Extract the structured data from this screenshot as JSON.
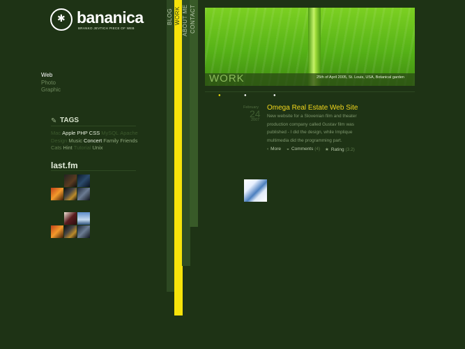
{
  "brand": {
    "name": "bananica",
    "tagline": "BRANKO JEVTICH PIECE OF WEB"
  },
  "left_nav": [
    "Web",
    "Photo",
    "Graphic"
  ],
  "tags": {
    "title": "TAGS",
    "lines": [
      [
        {
          "t": "Mac",
          "w": "dim"
        },
        {
          "t": "Apple",
          "w": "bright"
        },
        {
          "t": "PHP",
          "w": "bright"
        },
        {
          "t": "CSS",
          "w": "bright"
        },
        {
          "t": "MySQL",
          "w": "dim"
        },
        {
          "t": "Apache",
          "w": "dim"
        }
      ],
      [
        {
          "t": "Design",
          "w": "dim"
        },
        {
          "t": "Music",
          "w": "mid"
        },
        {
          "t": "Concert",
          "w": "bright"
        },
        {
          "t": "Family",
          "w": "mid"
        },
        {
          "t": "Friends",
          "w": "mid"
        }
      ],
      [
        {
          "t": "Cats",
          "w": "low"
        },
        {
          "t": "Hint",
          "w": "mid"
        },
        {
          "t": "Tutorial",
          "w": "dim"
        },
        {
          "t": "Unix",
          "w": "mid"
        }
      ]
    ]
  },
  "lastfm": {
    "title": "last.fm"
  },
  "vertical_nav": [
    "BLOG",
    "WORK",
    "ABOUT ME",
    "CONTACT"
  ],
  "hero": {
    "word": "WORK",
    "caption": "25th of April 2005, St. Louis, USA, Botanical garden"
  },
  "dots_colors": [
    "#f7e30a",
    "#ffffff",
    "#ffffff"
  ],
  "post": {
    "month": "February",
    "day": "24",
    "year": "2007",
    "title": "Omega Real Estate Web Site",
    "body": "New website for a Slovenian film and theater production company called Gustav film was published - I did the design, while Implique multimedia did the programming part.",
    "more": "More",
    "comments_label": "Comments",
    "comments_count": "(4)",
    "rating_label": "Rating",
    "rating_value": "(3.2)"
  },
  "colors": {
    "background": "#1e3315",
    "accent_yellow": "#f7e30a",
    "title_yellow": "#f2d71c"
  }
}
